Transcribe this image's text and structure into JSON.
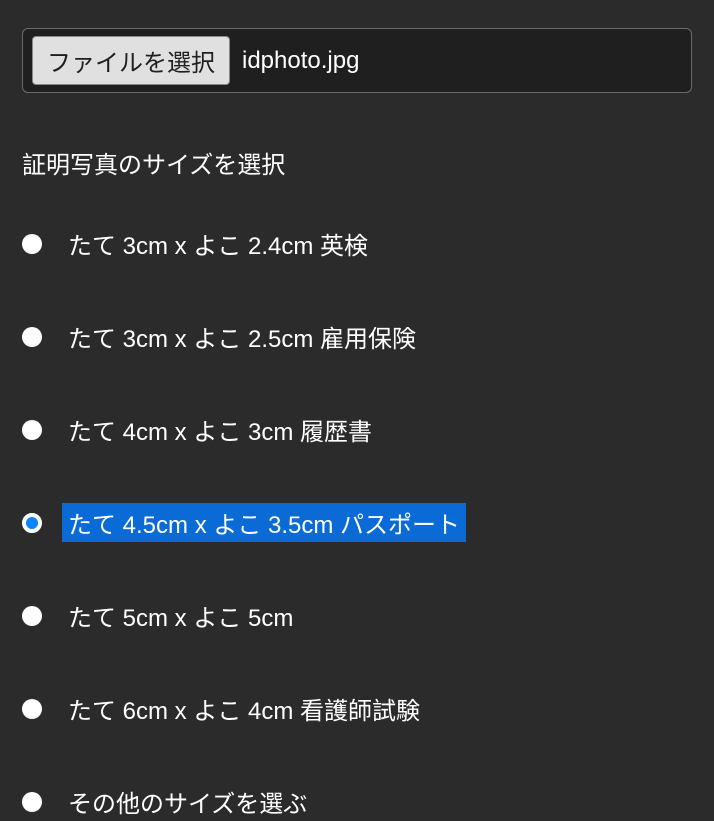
{
  "file": {
    "button_label": "ファイルを選択",
    "selected_name": "idphoto.jpg"
  },
  "section_heading": "証明写真のサイズを選択",
  "options": [
    {
      "label": "たて 3cm x よこ 2.4cm  英検",
      "selected": false
    },
    {
      "label": "たて 3cm x よこ 2.5cm  雇用保険",
      "selected": false
    },
    {
      "label": "たて 4cm x よこ 3cm  履歴書",
      "selected": false
    },
    {
      "label": "たて 4.5cm x よこ 3.5cm  パスポート",
      "selected": true
    },
    {
      "label": "たて 5cm x よこ 5cm",
      "selected": false
    },
    {
      "label": "たて 6cm x よこ 4cm  看護師試験",
      "selected": false
    },
    {
      "label": "その他のサイズを選ぶ",
      "selected": false
    }
  ]
}
